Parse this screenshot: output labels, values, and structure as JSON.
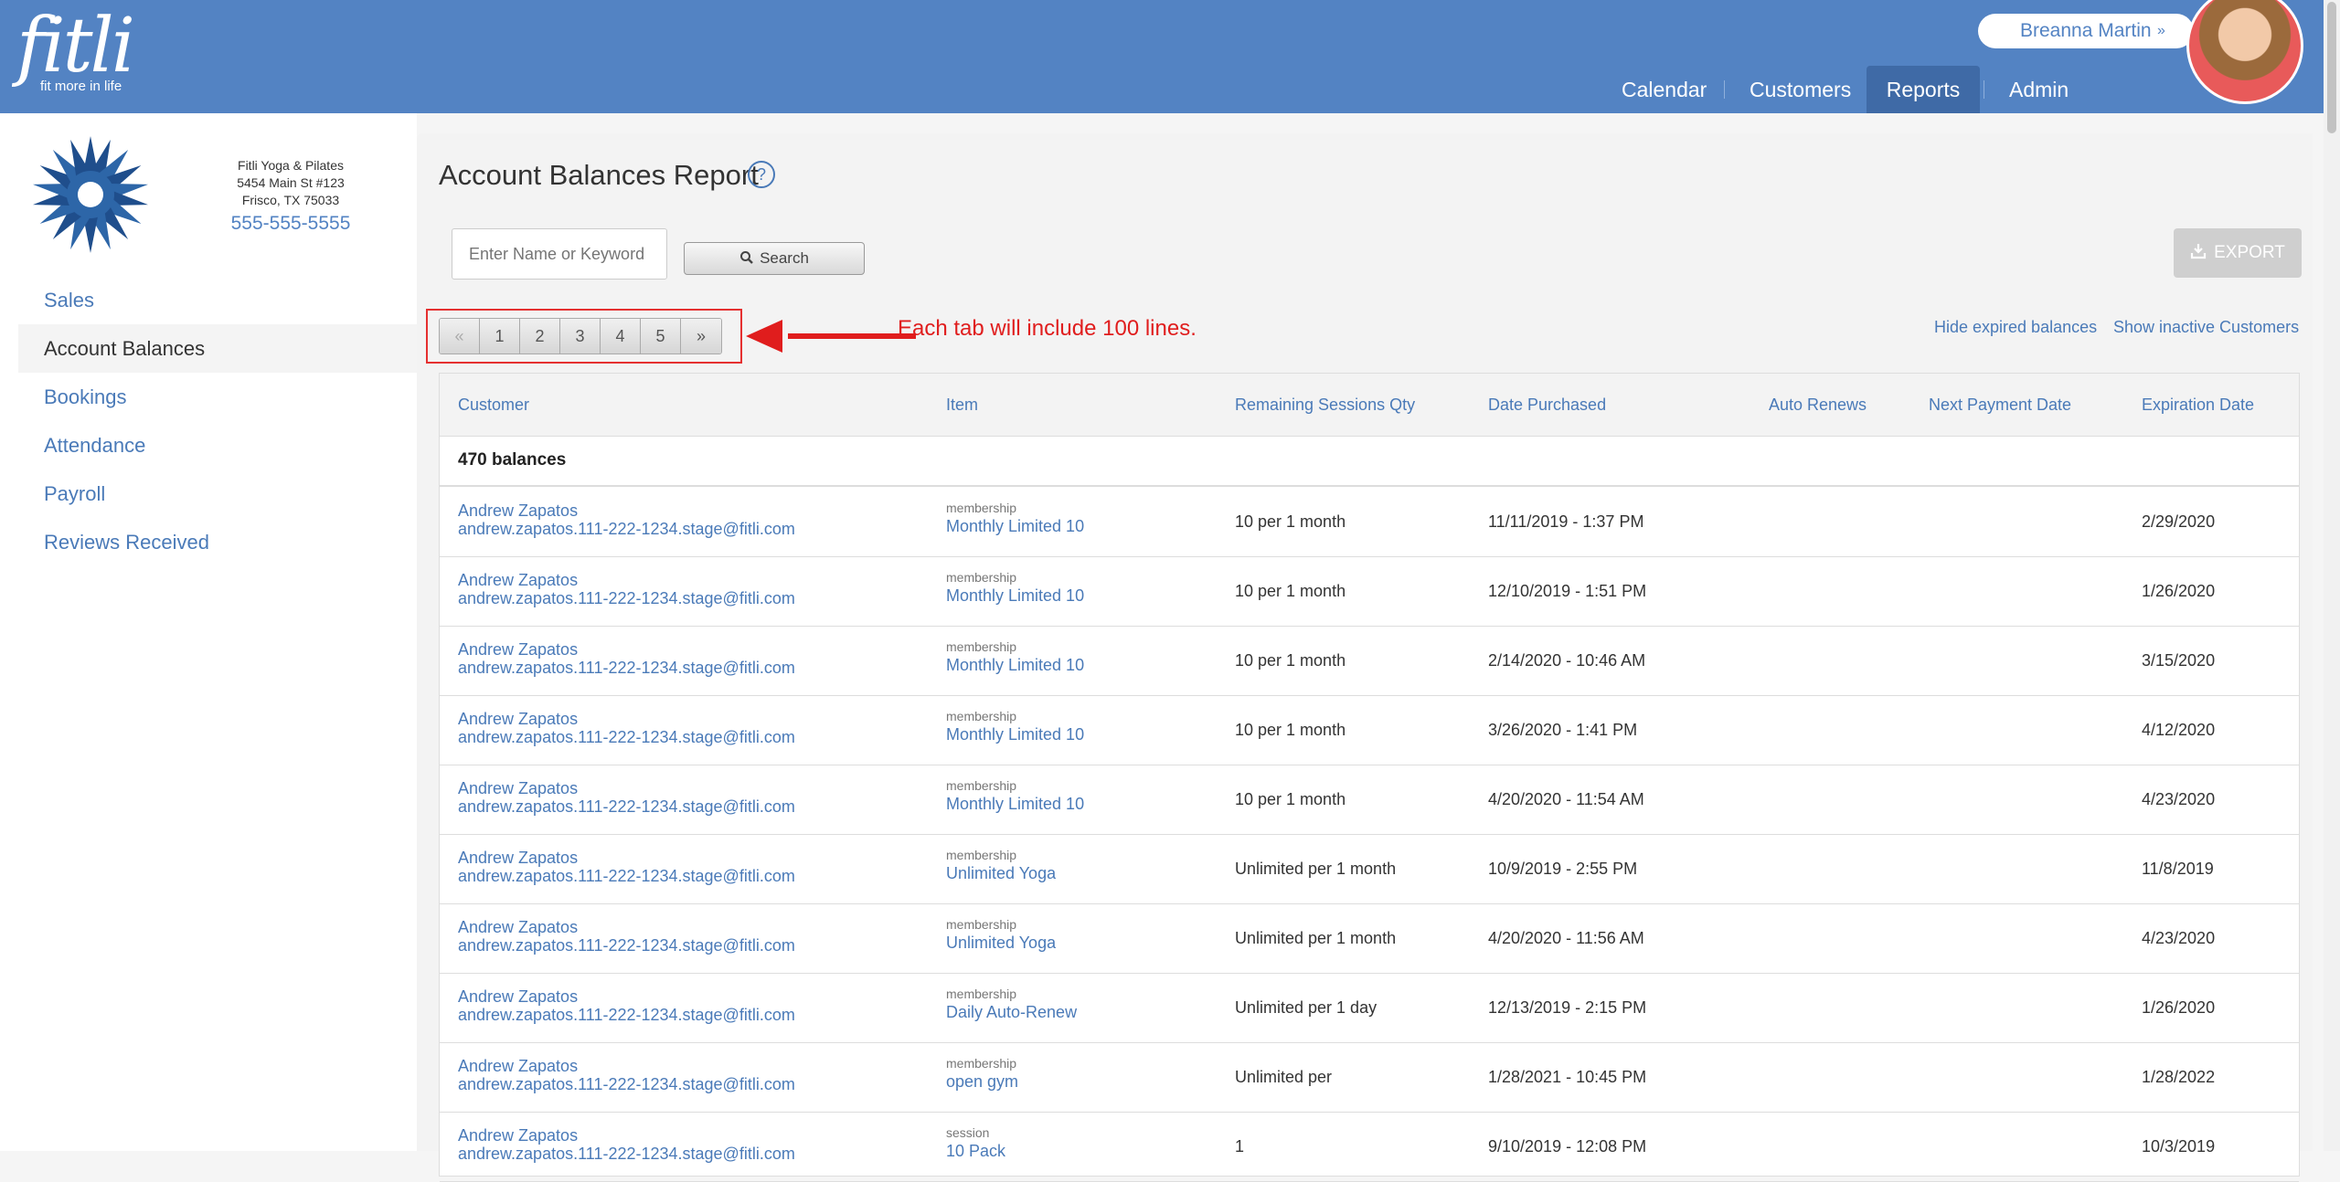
{
  "brand": {
    "name": "fitli",
    "tagline": "fit more in life"
  },
  "user": {
    "name": "Breanna Martin",
    "chevron": "»"
  },
  "nav": [
    {
      "label": "Calendar"
    },
    {
      "label": "Customers"
    },
    {
      "label": "Reports",
      "active": true
    },
    {
      "label": "Admin"
    }
  ],
  "studio": {
    "name": "Fitli Yoga & Pilates",
    "address1": "5454 Main St #123",
    "address2": "Frisco, TX 75033",
    "phone": "555-555-5555"
  },
  "sidebar": {
    "items": [
      {
        "label": "Sales"
      },
      {
        "label": "Account Balances",
        "active": true
      },
      {
        "label": "Bookings"
      },
      {
        "label": "Attendance"
      },
      {
        "label": "Payroll"
      },
      {
        "label": "Reviews Received"
      }
    ]
  },
  "page": {
    "title": "Account Balances Report",
    "help": "?",
    "search_placeholder": "Enter Name or Keyword",
    "search_label": "Search",
    "export_label": "EXPORT",
    "annotation": "Each tab will include 100 lines.",
    "hide_expired": "Hide expired balances",
    "show_inactive": "Show inactive Customers"
  },
  "pagination": {
    "prev": "«",
    "pages": [
      "1",
      "2",
      "3",
      "4",
      "5"
    ],
    "next": "»"
  },
  "table": {
    "headers": {
      "customer": "Customer",
      "item": "Item",
      "remaining": "Remaining Sessions Qty",
      "date_purchased": "Date Purchased",
      "auto_renews": "Auto Renews",
      "next_payment": "Next Payment Date",
      "expiration": "Expiration Date"
    },
    "count_label": "470 balances",
    "rows": [
      {
        "name": "Andrew Zapatos",
        "email": "andrew.zapatos.111-222-1234.stage@fitli.com",
        "item_type": "membership",
        "item_name": "Monthly Limited 10",
        "remaining": "10 per 1 month",
        "purchased": "11/11/2019 - 1:37 PM",
        "auto_renews": "",
        "next_payment": "",
        "expiration": "2/29/2020"
      },
      {
        "name": "Andrew Zapatos",
        "email": "andrew.zapatos.111-222-1234.stage@fitli.com",
        "item_type": "membership",
        "item_name": "Monthly Limited 10",
        "remaining": "10 per 1 month",
        "purchased": "12/10/2019 - 1:51 PM",
        "auto_renews": "",
        "next_payment": "",
        "expiration": "1/26/2020"
      },
      {
        "name": "Andrew Zapatos",
        "email": "andrew.zapatos.111-222-1234.stage@fitli.com",
        "item_type": "membership",
        "item_name": "Monthly Limited 10",
        "remaining": "10 per 1 month",
        "purchased": "2/14/2020 - 10:46 AM",
        "auto_renews": "",
        "next_payment": "",
        "expiration": "3/15/2020"
      },
      {
        "name": "Andrew Zapatos",
        "email": "andrew.zapatos.111-222-1234.stage@fitli.com",
        "item_type": "membership",
        "item_name": "Monthly Limited 10",
        "remaining": "10 per 1 month",
        "purchased": "3/26/2020 - 1:41 PM",
        "auto_renews": "",
        "next_payment": "",
        "expiration": "4/12/2020"
      },
      {
        "name": "Andrew Zapatos",
        "email": "andrew.zapatos.111-222-1234.stage@fitli.com",
        "item_type": "membership",
        "item_name": "Monthly Limited 10",
        "remaining": "10 per 1 month",
        "purchased": "4/20/2020 - 11:54 AM",
        "auto_renews": "",
        "next_payment": "",
        "expiration": "4/23/2020"
      },
      {
        "name": "Andrew Zapatos",
        "email": "andrew.zapatos.111-222-1234.stage@fitli.com",
        "item_type": "membership",
        "item_name": "Unlimited Yoga",
        "remaining": "Unlimited per 1 month",
        "purchased": "10/9/2019 - 2:55 PM",
        "auto_renews": "",
        "next_payment": "",
        "expiration": "11/8/2019"
      },
      {
        "name": "Andrew Zapatos",
        "email": "andrew.zapatos.111-222-1234.stage@fitli.com",
        "item_type": "membership",
        "item_name": "Unlimited Yoga",
        "remaining": "Unlimited per 1 month",
        "purchased": "4/20/2020 - 11:56 AM",
        "auto_renews": "",
        "next_payment": "",
        "expiration": "4/23/2020"
      },
      {
        "name": "Andrew Zapatos",
        "email": "andrew.zapatos.111-222-1234.stage@fitli.com",
        "item_type": "membership",
        "item_name": "Daily Auto-Renew",
        "remaining": "Unlimited per 1 day",
        "purchased": "12/13/2019 - 2:15 PM",
        "auto_renews": "",
        "next_payment": "",
        "expiration": "1/26/2020"
      },
      {
        "name": "Andrew Zapatos",
        "email": "andrew.zapatos.111-222-1234.stage@fitli.com",
        "item_type": "membership",
        "item_name": "open gym",
        "remaining": "Unlimited per",
        "purchased": "1/28/2021 - 10:45 PM",
        "auto_renews": "",
        "next_payment": "",
        "expiration": "1/28/2022"
      },
      {
        "name": "Andrew Zapatos",
        "email": "andrew.zapatos.111-222-1234.stage@fitli.com",
        "item_type": "session",
        "item_name": "10 Pack",
        "remaining": "1",
        "purchased": "9/10/2019 - 12:08 PM",
        "auto_renews": "",
        "next_payment": "",
        "expiration": "10/3/2019"
      }
    ]
  }
}
